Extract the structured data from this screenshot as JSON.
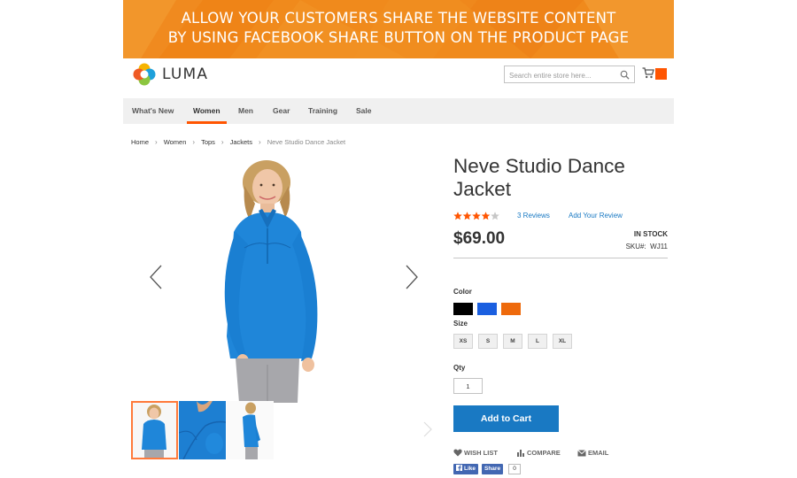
{
  "banner": {
    "line1": "ALLOW YOUR CUSTOMERS SHARE THE WEBSITE CONTENT",
    "line2": "BY USING FACEBOOK SHARE BUTTON ON THE PRODUCT PAGE",
    "color": "#f08a1c"
  },
  "header": {
    "logo_text": "LUMA",
    "search_placeholder": "Search entire store here...",
    "accent": "#ff5501"
  },
  "nav": {
    "items": [
      "What's New",
      "Women",
      "Men",
      "Gear",
      "Training",
      "Sale"
    ],
    "active": "Women"
  },
  "breadcrumb": [
    "Home",
    "Women",
    "Tops",
    "Jackets",
    "Neve Studio Dance Jacket"
  ],
  "product": {
    "title": "Neve Studio Dance Jacket",
    "rating_stars": 4,
    "rating_max": 5,
    "reviews_link": "3 Reviews",
    "add_review_link": "Add Your Review",
    "price": "$69.00",
    "stock": "IN STOCK",
    "sku_label": "SKU#:",
    "sku": "WJ11",
    "color_label": "Color",
    "colors": [
      "#000000",
      "#1a5fe0",
      "#ee6a0c"
    ],
    "size_label": "Size",
    "sizes": [
      "XS",
      "S",
      "M",
      "L",
      "XL"
    ],
    "qty_label": "Qty",
    "qty_value": "1",
    "add_to_cart": "Add to Cart",
    "actions": {
      "wishlist": "WISH LIST",
      "compare": "COMPARE",
      "email": "EMAIL"
    },
    "facebook": {
      "like": "Like",
      "share": "Share",
      "count": "0"
    },
    "link_color": "#1979c3",
    "jacket_color": "#1f86d9"
  }
}
